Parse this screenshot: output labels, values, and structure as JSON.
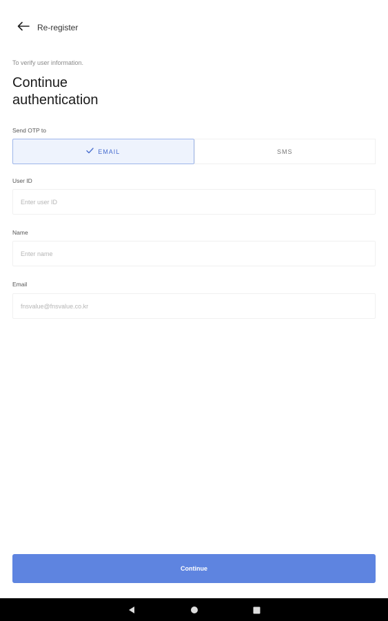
{
  "header": {
    "back_icon": "arrow-left-icon",
    "title": "Re-register"
  },
  "intro": {
    "subtitle": "To verify user information.",
    "heading_line1": "Continue",
    "heading_line2": "authentication"
  },
  "otp": {
    "label": "Send OTP to",
    "options": [
      {
        "label": "EMAIL",
        "selected": true,
        "icon": "checkmark-icon"
      },
      {
        "label": "SMS",
        "selected": false
      }
    ]
  },
  "form": {
    "user_id": {
      "label": "User ID",
      "placeholder": "Enter user ID",
      "value": ""
    },
    "name": {
      "label": "Name",
      "placeholder": "Enter name",
      "value": ""
    },
    "email": {
      "label": "Email",
      "value": "fnsvalue@fnsvalue.co.kr",
      "disabled": true
    }
  },
  "actions": {
    "continue_label": "Continue"
  },
  "colors": {
    "accent": "#5e84e0",
    "selected_bg": "#eef3fd",
    "selected_border": "#9db5ea",
    "nav_bar": "#000000"
  },
  "system_nav": {
    "buttons": [
      "back-triangle-icon",
      "home-circle-icon",
      "recents-square-icon"
    ]
  }
}
